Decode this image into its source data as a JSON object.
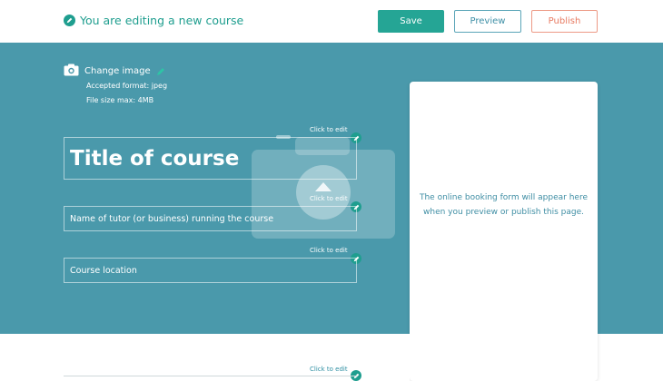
{
  "header": {
    "status_text": "You are editing a new course",
    "buttons": {
      "save_label": "Save",
      "preview_label": "Preview",
      "publish_label": "Publish"
    }
  },
  "hero": {
    "change_image_label": "Change image",
    "accepted_format": "Accepted format: jpeg",
    "file_size": "File size max: 4MB",
    "click_to_edit": "Click to edit",
    "title_field": "Title of course",
    "tutor_field": "Name of tutor (or business) running the course",
    "location_field": "Course location"
  },
  "booking": {
    "text": "The online booking form will appear here when you preview or publish this page."
  },
  "lower": {
    "click_to_edit": "Click to edit"
  },
  "colors": {
    "brand": "#1f9e8f",
    "hero_bg": "#4a99ab",
    "publish": "#e87b62"
  },
  "icons": [
    "pencil-icon",
    "camera-icon"
  ]
}
